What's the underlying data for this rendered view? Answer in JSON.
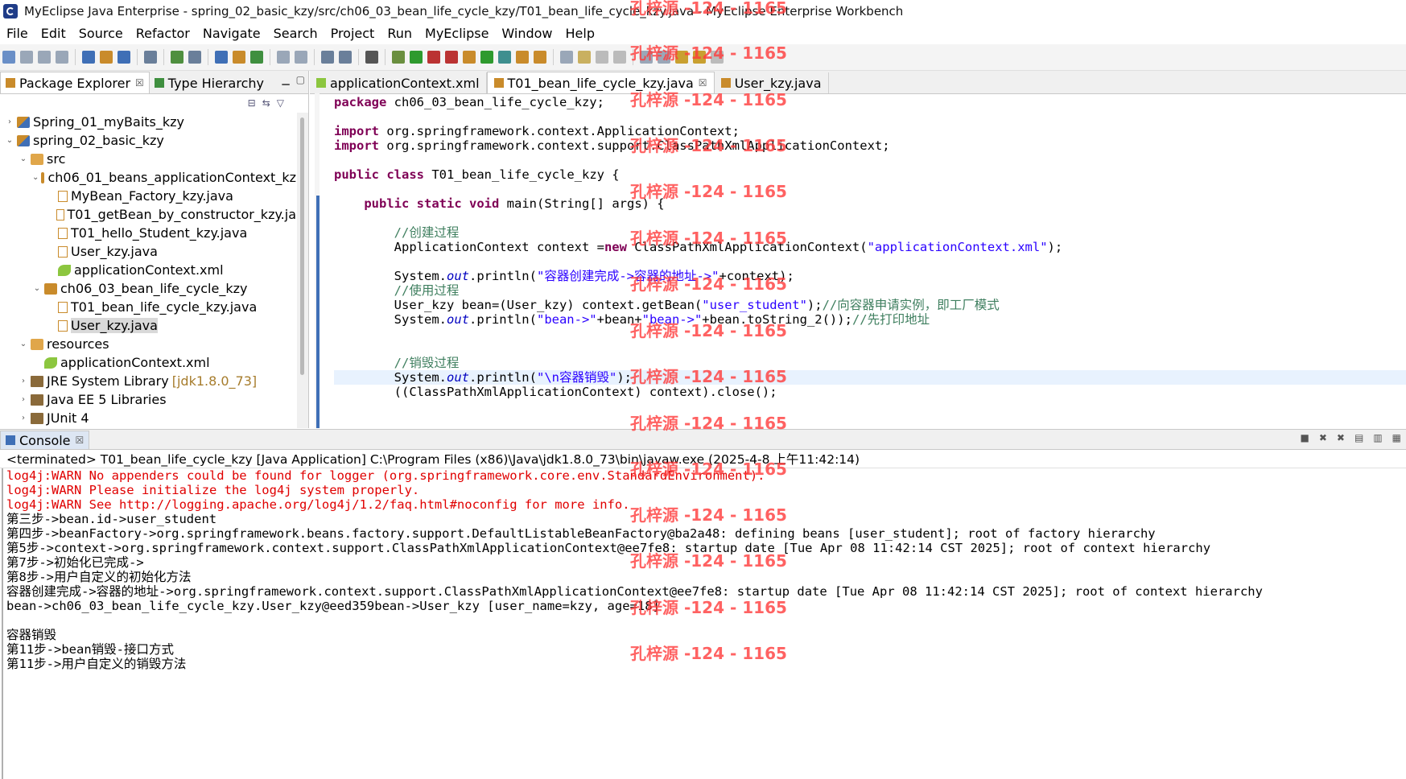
{
  "window": {
    "title": "MyEclipse Java Enterprise - spring_02_basic_kzy/src/ch06_03_bean_life_cycle_kzy/T01_bean_life_cycle_kzy.java - MyEclipse Enterprise Workbench"
  },
  "menu": [
    "File",
    "Edit",
    "Source",
    "Refactor",
    "Navigate",
    "Search",
    "Project",
    "Run",
    "MyEclipse",
    "Window",
    "Help"
  ],
  "left_tabs": [
    {
      "label": "Package Explorer",
      "close": "☒"
    },
    {
      "label": "Type Hierarchy"
    }
  ],
  "tree": [
    {
      "label": "Spring_01_myBaits_kzy",
      "level": 1,
      "icon": "project-icon",
      "twisty": "›"
    },
    {
      "label": "spring_02_basic_kzy",
      "level": 1,
      "icon": "project-icon",
      "twisty": "⌄"
    },
    {
      "label": "src",
      "level": 2,
      "icon": "package-folder-icon",
      "twisty": "⌄"
    },
    {
      "label": "ch06_01_beans_applicationContext_kz",
      "level": 3,
      "icon": "package-icon",
      "twisty": "⌄"
    },
    {
      "label": "MyBean_Factory_kzy.java",
      "level": 4,
      "icon": "java-file-icon",
      "twisty": ""
    },
    {
      "label": "T01_getBean_by_constructor_kzy.ja",
      "level": 4,
      "icon": "java-file-icon",
      "twisty": ""
    },
    {
      "label": "T01_hello_Student_kzy.java",
      "level": 4,
      "icon": "java-file-icon",
      "twisty": ""
    },
    {
      "label": "User_kzy.java",
      "level": 4,
      "icon": "java-file-icon",
      "twisty": ""
    },
    {
      "label": "applicationContext.xml",
      "level": 4,
      "icon": "xml-file-icon",
      "twisty": ""
    },
    {
      "label": "ch06_03_bean_life_cycle_kzy",
      "level": 3,
      "icon": "package-icon",
      "twisty": "⌄"
    },
    {
      "label": "T01_bean_life_cycle_kzy.java",
      "level": 4,
      "icon": "java-file-icon",
      "twisty": ""
    },
    {
      "label": "User_kzy.java",
      "level": 4,
      "icon": "java-file-icon",
      "twisty": "",
      "selected": true
    },
    {
      "label": "resources",
      "level": 2,
      "icon": "package-folder-icon",
      "twisty": "⌄"
    },
    {
      "label": "applicationContext.xml",
      "level": 3,
      "icon": "xml-file-icon",
      "twisty": ""
    },
    {
      "label": "JRE System Library",
      "hint": "[jdk1.8.0_73]",
      "level": 2,
      "icon": "library-icon",
      "twisty": "›"
    },
    {
      "label": "Java EE 5 Libraries",
      "level": 2,
      "icon": "library-icon",
      "twisty": "›"
    },
    {
      "label": "JUnit 4",
      "level": 2,
      "icon": "library-icon",
      "twisty": "›"
    }
  ],
  "editor_tabs": [
    {
      "label": "applicationContext.xml",
      "icon": "xml-file-icon"
    },
    {
      "label": "T01_bean_life_cycle_kzy.java",
      "icon": "java-file-icon",
      "active": true,
      "close": "☒"
    },
    {
      "label": "User_kzy.java",
      "icon": "java-file-icon"
    }
  ],
  "code": [
    [
      {
        "t": "package",
        "c": "kw"
      },
      {
        "t": " ch06_03_bean_life_cycle_kzy;"
      }
    ],
    [],
    [
      {
        "t": "import",
        "c": "kw"
      },
      {
        "t": " org.springframework.context.ApplicationContext;"
      }
    ],
    [
      {
        "t": "import",
        "c": "kw"
      },
      {
        "t": " org.springframework.context.support.ClassPathXmlApplicationContext;"
      }
    ],
    [],
    [
      {
        "t": "public",
        "c": "kw"
      },
      {
        "t": " "
      },
      {
        "t": "class",
        "c": "kw"
      },
      {
        "t": " T01_bean_life_cycle_kzy {"
      }
    ],
    [],
    [
      {
        "t": "    "
      },
      {
        "t": "public",
        "c": "kw"
      },
      {
        "t": " "
      },
      {
        "t": "static",
        "c": "kw"
      },
      {
        "t": " "
      },
      {
        "t": "void",
        "c": "kw"
      },
      {
        "t": " main(String[] args) {"
      }
    ],
    [],
    [
      {
        "t": "        "
      },
      {
        "t": "//创建过程",
        "c": "cm"
      }
    ],
    [
      {
        "t": "        ApplicationContext context ="
      },
      {
        "t": "new",
        "c": "kw"
      },
      {
        "t": " ClassPathXmlApplicationContext("
      },
      {
        "t": "\"applicationContext.xml\"",
        "c": "str"
      },
      {
        "t": ");"
      }
    ],
    [],
    [
      {
        "t": "        System."
      },
      {
        "t": "out",
        "c": "fld"
      },
      {
        "t": ".println("
      },
      {
        "t": "\"容器创建完成->容器的地址->\"",
        "c": "str"
      },
      {
        "t": "+context);"
      }
    ],
    [
      {
        "t": "        "
      },
      {
        "t": "//使用过程",
        "c": "cm"
      }
    ],
    [
      {
        "t": "        User_kzy bean=(User_kzy) context.getBean("
      },
      {
        "t": "\"user_student\"",
        "c": "str"
      },
      {
        "t": ");"
      },
      {
        "t": "//向容器申请实例，即工厂模式",
        "c": "cm"
      }
    ],
    [
      {
        "t": "        System."
      },
      {
        "t": "out",
        "c": "fld"
      },
      {
        "t": ".println("
      },
      {
        "t": "\"bean->\"",
        "c": "str"
      },
      {
        "t": "+bean+"
      },
      {
        "t": "\"bean->\"",
        "c": "str"
      },
      {
        "t": "+bean.toString_2());"
      },
      {
        "t": "//先打印地址",
        "c": "cm"
      }
    ],
    [],
    [],
    [
      {
        "t": "        "
      },
      {
        "t": "//销毁过程",
        "c": "cm"
      }
    ],
    [
      {
        "t": "        System."
      },
      {
        "t": "out",
        "c": "fld"
      },
      {
        "t": ".println("
      },
      {
        "t": "\"\\n容器销毁\"",
        "c": "str"
      },
      {
        "t": ");"
      }
    ],
    [
      {
        "t": "        ((ClassPathXmlApplicationContext) context).close();"
      }
    ]
  ],
  "console": {
    "tab_label": "Console",
    "tab_close": "☒",
    "terminated": "<terminated> T01_bean_life_cycle_kzy [Java Application] C:\\Program Files (x86)\\Java\\jdk1.8.0_73\\bin\\javaw.exe (2025-4-8 上午11:42:14)",
    "lines": [
      {
        "text": "log4j:WARN No appenders could be found for logger (org.springframework.core.env.StandardEnvironment).",
        "err": true
      },
      {
        "text": "log4j:WARN Please initialize the log4j system properly.",
        "err": true
      },
      {
        "text": "log4j:WARN See http://logging.apache.org/log4j/1.2/faq.html#noconfig for more info.",
        "err": true
      },
      {
        "text": "第三步->bean.id->user_student"
      },
      {
        "text": "第四步->beanFactory->org.springframework.beans.factory.support.DefaultListableBeanFactory@ba2a48: defining beans [user_student]; root of factory hierarchy"
      },
      {
        "text": "第5步->context->org.springframework.context.support.ClassPathXmlApplicationContext@ee7fe8: startup date [Tue Apr 08 11:42:14 CST 2025]; root of context hierarchy"
      },
      {
        "text": "第7步->初始化已完成->"
      },
      {
        "text": "第8步->用户自定义的初始化方法"
      },
      {
        "text": "容器创建完成->容器的地址->org.springframework.context.support.ClassPathXmlApplicationContext@ee7fe8: startup date [Tue Apr 08 11:42:14 CST 2025]; root of context hierarchy"
      },
      {
        "text": "bean->ch06_03_bean_life_cycle_kzy.User_kzy@eed359bean->User_kzy [user_name=kzy, age=18]"
      },
      {
        "text": ""
      },
      {
        "text": "容器销毁"
      },
      {
        "text": "第11步->bean销毁-接口方式"
      },
      {
        "text": "第11步->用户自定义的销毁方法"
      }
    ]
  },
  "watermark": "孔梓源 -124 - 1165",
  "colors": {
    "keyword": "#7f0055",
    "string": "#2a00ff",
    "comment": "#3f7f5f",
    "error": "#e00000"
  }
}
